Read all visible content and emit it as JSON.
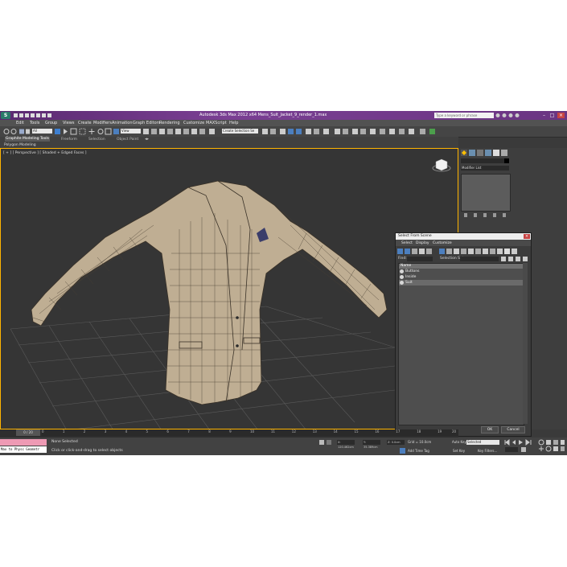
{
  "app": {
    "logo": "S",
    "title": "Autodesk 3ds Max  2012 x64       Mens_Suit_Jacket_9_render_1.max",
    "search_placeholder": "Type a keyword or phrase"
  },
  "menu": [
    "Edit",
    "Tools",
    "Group",
    "Views",
    "Create",
    "Modifiers",
    "Animation",
    "Graph Editors",
    "Rendering",
    "Customize",
    "MAXScript",
    "Help"
  ],
  "toolbar": {
    "selection_filter": "All",
    "reference_coord": "View",
    "named_selection_set": "Create Selection Se"
  },
  "ribbon": {
    "tabs": [
      "Graphite Modeling Tools",
      "Freeform",
      "Selection",
      "Object Paint"
    ],
    "panel_label": "Polygon Modeling"
  },
  "viewport": {
    "label": "[ + ] [ Perspective ] [ Shaded + Edged Faces ]"
  },
  "command_panel": {
    "modifier_list": "Modifier List"
  },
  "dialog": {
    "title": "Select From Scene",
    "menu": [
      "Select",
      "Display",
      "Customize"
    ],
    "find_label": "Find:",
    "selection_set_label": "Selection Set:",
    "column_header": "Name",
    "rows": [
      "Buttons",
      "Inside",
      "Suit"
    ],
    "selected_row": 2,
    "ok_label": "OK",
    "cancel_label": "Cancel"
  },
  "timeline": {
    "frame_display": "0 / 20",
    "ticks": [
      "0",
      "1",
      "2",
      "3",
      "4",
      "5",
      "6",
      "7",
      "8",
      "9",
      "10",
      "11",
      "12",
      "13",
      "14",
      "15",
      "16",
      "17",
      "18",
      "19",
      "20"
    ]
  },
  "status": {
    "maxscript": "Max to Physc Geometr",
    "selection_status": "None Selected",
    "prompt": "Click or click-and-drag to select objects",
    "x": "X:  120.462cm",
    "y": "Y:  35.389cm",
    "z": "Z:  0.0cm",
    "grid": "Grid = 10.0cm",
    "add_time_tag": "Add Time Tag",
    "auto_key": "Auto Key",
    "key_mode": "Selected",
    "set_key": "Set Key",
    "key_filters": "Key Filters..."
  },
  "colors": {
    "title_bar": "#6a3582",
    "viewport_border": "#ffb400",
    "jacket": "#bfae93",
    "grid": "#5a5a5a"
  }
}
